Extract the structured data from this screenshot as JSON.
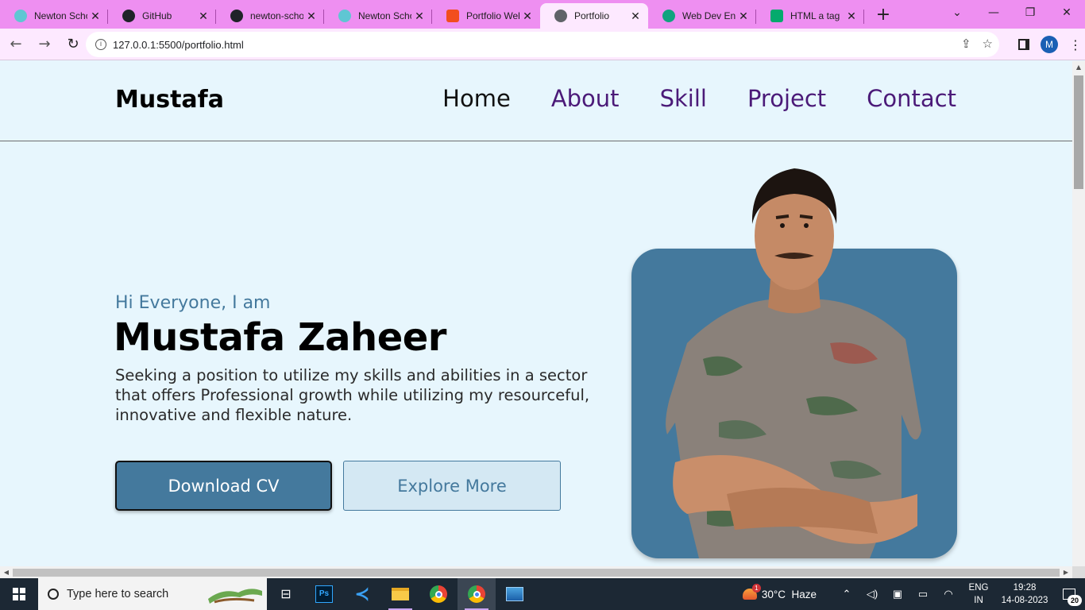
{
  "browser": {
    "tabs": [
      {
        "label": "Newton Scho",
        "favicon_color": "#5fc6d3"
      },
      {
        "label": "GitHub",
        "favicon_color": "#1f2328"
      },
      {
        "label": "newton-scho",
        "favicon_color": "#1f2328"
      },
      {
        "label": "Newton Scho",
        "favicon_color": "#5fc6d3"
      },
      {
        "label": "Portfolio Web",
        "favicon_color": "#f24e1e"
      },
      {
        "label": "Portfolio",
        "favicon_color": "#5f6368"
      },
      {
        "label": "Web Dev Enth",
        "favicon_color": "#10a37f"
      },
      {
        "label": "HTML a tag",
        "favicon_color": "#04aa6d"
      }
    ],
    "new_tab": "+",
    "url": "127.0.0.1:5500/portfolio.html",
    "profile_initial": "M",
    "tab_bar_color": "#ee8ff1"
  },
  "site": {
    "logo": "Mustafa",
    "nav": [
      {
        "label": "Home"
      },
      {
        "label": "About"
      },
      {
        "label": "Skill"
      },
      {
        "label": "Project"
      },
      {
        "label": "Contact"
      }
    ],
    "hero": {
      "greeting": "Hi Everyone, I am",
      "name": "Mustafa Zaheer",
      "description": "Seeking a position to utilize my skills and abilities in a sector that offers Professional growth while utilizing my resourceful, innovative and flexible nature.",
      "primary_button": "Download CV",
      "secondary_button": "Explore More"
    },
    "colors": {
      "accent": "#44799d",
      "background": "#e7f6fd",
      "nav_link": "#4b1a78"
    }
  },
  "taskbar": {
    "search_placeholder": "Type here to search",
    "weather": "30°C  Haze",
    "weather_badge": "1",
    "language": "ENG",
    "region": "IN",
    "time": "19:28",
    "date": "14-08-2023",
    "notification_count": "20"
  }
}
